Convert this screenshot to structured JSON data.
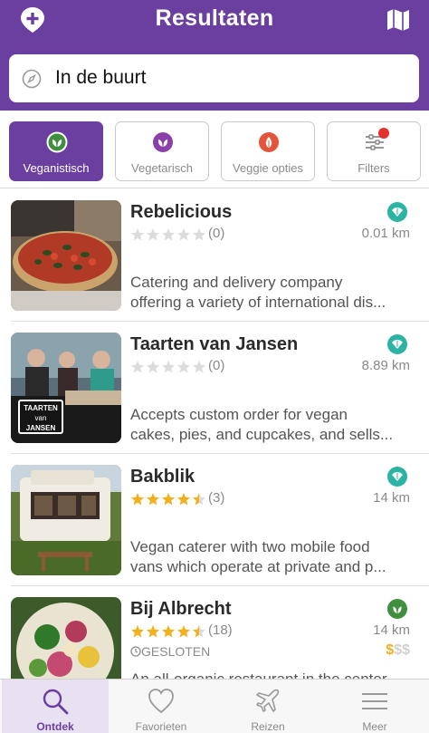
{
  "header": {
    "title": "Resultaten"
  },
  "search": {
    "value": "In de buurt"
  },
  "filters": [
    {
      "label": "Veganistisch",
      "active": true
    },
    {
      "label": "Vegetarisch",
      "active": false
    },
    {
      "label": "Veggie opties",
      "active": false
    },
    {
      "label": "Filters",
      "active": false
    }
  ],
  "results": [
    {
      "name": "Rebelicious",
      "rating": 0,
      "count": "(0)",
      "distance": "0.01 km",
      "badge": "leaf-badge-icon",
      "desc1": "Catering and delivery company",
      "desc2": "offering a variety of international dis..."
    },
    {
      "name": "Taarten van Jansen",
      "rating": 0,
      "count": "(0)",
      "distance": "8.89 km",
      "badge": "leaf-badge-icon",
      "sign1": "TAARTEN",
      "sign2": "van",
      "sign3": "JANSEN",
      "desc1": "Accepts custom order for vegan",
      "desc2": "cakes, pies, and cupcakes, and sells..."
    },
    {
      "name": "Bakblik",
      "rating": 4.5,
      "count": "(3)",
      "distance": "14 km",
      "badge": "leaf-badge-icon",
      "desc1": "Vegan caterer with two mobile food",
      "desc2": "vans which operate at private and p..."
    },
    {
      "name": "Bij Albrecht",
      "rating": 4.5,
      "count": "(18)",
      "distance": "14 km",
      "badge": "vegan-badge-icon",
      "status": "GESLOTEN",
      "price_active": "$",
      "price_inactive": "$$",
      "desc1": "An all-organic restaurant in the center"
    }
  ],
  "tabs": [
    {
      "label": "Ontdek",
      "active": true
    },
    {
      "label": "Favorieten",
      "active": false
    },
    {
      "label": "Reizen",
      "active": false
    },
    {
      "label": "Meer",
      "active": false
    }
  ],
  "colors": {
    "brand": "#6b3fa0",
    "vegan_badge": "#2bb3a3",
    "vegan_green": "#3f8f3f",
    "star": "#f2b01e",
    "price_active": "#f2b01e",
    "notification_dot": "#e53030"
  }
}
